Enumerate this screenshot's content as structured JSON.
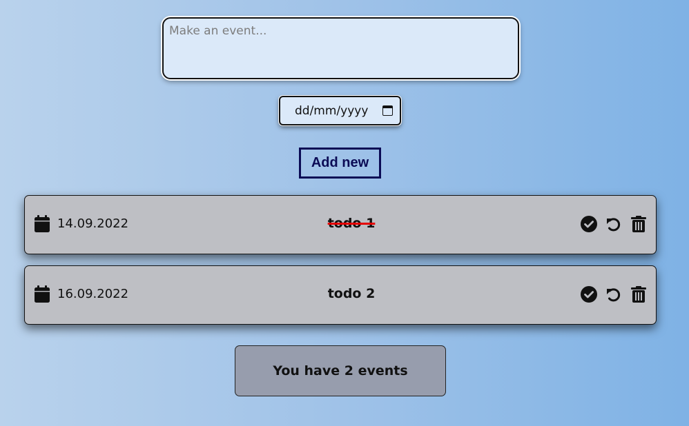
{
  "form": {
    "event_placeholder": "Make an event...",
    "date_placeholder": "dd/mm/yyyy",
    "add_label": "Add new"
  },
  "events": [
    {
      "date": "14.09.2022",
      "title": "todo 1",
      "completed": true
    },
    {
      "date": "16.09.2022",
      "title": "todo 2",
      "completed": false
    }
  ],
  "icons": {
    "date": "calendar-icon",
    "complete": "check-circle-icon",
    "undo": "undo-icon",
    "delete": "trash-icon"
  },
  "colors": {
    "strike": "#e50000",
    "button_border": "#0b0b55",
    "row_bg": "#bebfc4",
    "counter_bg": "#979dad"
  },
  "summary": {
    "text": "You have 2 events"
  }
}
